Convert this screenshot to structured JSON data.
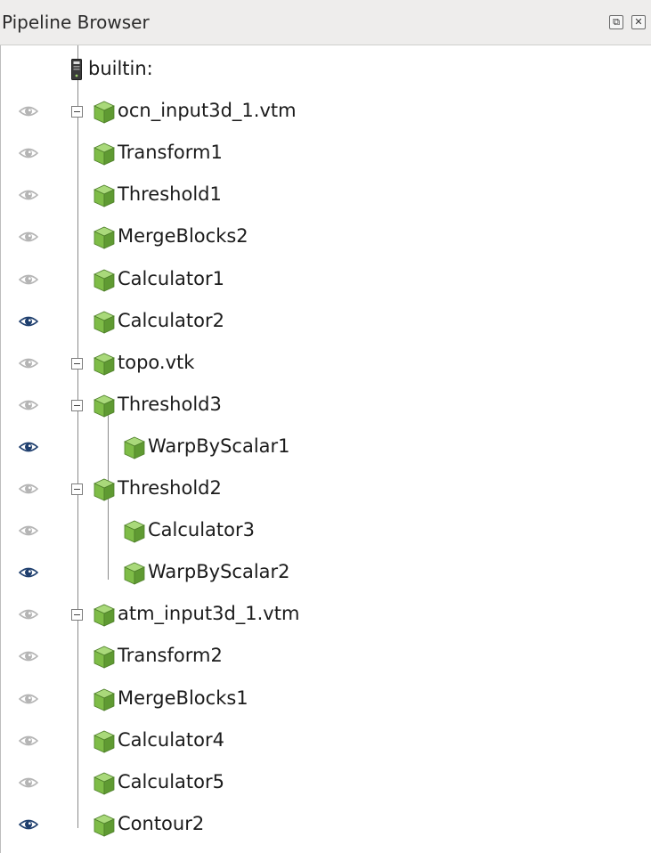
{
  "panel": {
    "title": "Pipeline Browser",
    "buttons": [
      {
        "name": "undock-button",
        "glyph": "⧉"
      },
      {
        "name": "close-button",
        "glyph": "✕"
      }
    ]
  },
  "colors": {
    "eye_visible": "#1f3f6e",
    "eye_hidden": "#b5b5b5",
    "cube_green": "#7ebc47"
  },
  "items": [
    {
      "label": "builtin:",
      "depth": 0,
      "icon": "server-icon",
      "eye": "none",
      "expand": false
    },
    {
      "label": "ocn_input3d_1.vtm",
      "depth": 0,
      "icon": "cube-icon",
      "eye": "hidden",
      "expand": true
    },
    {
      "label": "Transform1",
      "depth": 1,
      "icon": "cube-icon",
      "eye": "hidden",
      "expand": false
    },
    {
      "label": "Threshold1",
      "depth": 1,
      "icon": "cube-icon",
      "eye": "hidden",
      "expand": false
    },
    {
      "label": "MergeBlocks2",
      "depth": 1,
      "icon": "cube-icon",
      "eye": "hidden",
      "expand": false
    },
    {
      "label": "Calculator1",
      "depth": 1,
      "icon": "cube-icon",
      "eye": "hidden",
      "expand": false
    },
    {
      "label": "Calculator2",
      "depth": 1,
      "icon": "cube-icon",
      "eye": "visible",
      "expand": false
    },
    {
      "label": "topo.vtk",
      "depth": 0,
      "icon": "cube-icon",
      "eye": "hidden",
      "expand": true
    },
    {
      "label": "Threshold3",
      "depth": 1,
      "icon": "cube-icon",
      "eye": "hidden",
      "expand": true
    },
    {
      "label": "WarpByScalar1",
      "depth": 2,
      "icon": "cube-icon",
      "eye": "visible",
      "expand": false
    },
    {
      "label": "Threshold2",
      "depth": 1,
      "icon": "cube-icon",
      "eye": "hidden",
      "expand": true
    },
    {
      "label": "Calculator3",
      "depth": 2,
      "icon": "cube-icon",
      "eye": "hidden",
      "expand": false
    },
    {
      "label": "WarpByScalar2",
      "depth": 2,
      "icon": "cube-icon",
      "eye": "visible",
      "expand": false
    },
    {
      "label": "atm_input3d_1.vtm",
      "depth": 0,
      "icon": "cube-icon",
      "eye": "hidden",
      "expand": true
    },
    {
      "label": "Transform2",
      "depth": 1,
      "icon": "cube-icon",
      "eye": "hidden",
      "expand": false
    },
    {
      "label": "MergeBlocks1",
      "depth": 1,
      "icon": "cube-icon",
      "eye": "hidden",
      "expand": false
    },
    {
      "label": "Calculator4",
      "depth": 1,
      "icon": "cube-icon",
      "eye": "hidden",
      "expand": false
    },
    {
      "label": "Calculator5",
      "depth": 1,
      "icon": "cube-icon",
      "eye": "hidden",
      "expand": false
    },
    {
      "label": "Contour2",
      "depth": 1,
      "icon": "cube-icon",
      "eye": "visible",
      "expand": false
    }
  ]
}
